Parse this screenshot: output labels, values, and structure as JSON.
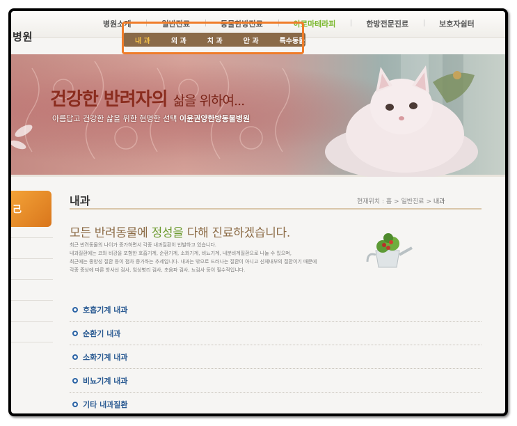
{
  "site": {
    "logo_text": "병원"
  },
  "topnav": {
    "items": [
      {
        "label": "병원소개"
      },
      {
        "label": "일반진료"
      },
      {
        "label": "동물한방진료"
      },
      {
        "label": "아로마테라피"
      },
      {
        "label": "한방전문진료"
      },
      {
        "label": "보호자쉼터"
      }
    ],
    "active_index": 3
  },
  "subnav": {
    "items": [
      {
        "label": "내 과"
      },
      {
        "label": "외 과"
      },
      {
        "label": "치 과"
      },
      {
        "label": "안 과"
      },
      {
        "label": "특수동물"
      }
    ],
    "active_index": 0
  },
  "banner": {
    "title_main": "건강한 반려자의",
    "title_small": "삶을 위하여...",
    "subtitle_prefix": "아름답고 건강한 삶을 위한 현명한 선택",
    "subtitle_strong": "이윤권양한방동물병원"
  },
  "sidebar": {
    "tab_label": "己"
  },
  "content": {
    "heading": "내과",
    "breadcrumb": {
      "prefix": "현재위치 :",
      "home": "홈",
      "sep1": ">",
      "section": "일반진료",
      "sep2": ">",
      "current": "내과"
    },
    "lead_prefix": "모든 반려동물에",
    "lead_green": "정성을",
    "lead_suffix": "다해 진료하겠습니다.",
    "paragraph": [
      "최근 반려동물의 나이가 증가하면서 각종 내과질환이 빈발하고 있습니다.",
      "내과질환에는 코와 비강을 포함한 호흡기계, 순환기계, 소화기계, 비뇨기계, 내분비계질환으로 나눌 수 있으며,",
      "최근에는 종양성 질환 등이 점차 증가하는 추세입니다. 내과는 밖으로 드러나는 질환이 아니고 신체내부의 질환이기 때문에",
      "각종 증상에 따른 방사선 검사, 임상병리 검사, 초음파 검사, 뇨검사 등이 필수적입니다."
    ],
    "list": [
      {
        "label": "호흡기계 내과"
      },
      {
        "label": "순환기 내과"
      },
      {
        "label": "소화기계 내과"
      },
      {
        "label": "비뇨기계 내과"
      },
      {
        "label": "기타 내과질환"
      }
    ]
  },
  "colors": {
    "highlight_box": "#f07d2a",
    "subnav_bg": "#8a6a48",
    "active_menu": "#7cb82f",
    "list_text": "#2a5a92"
  }
}
